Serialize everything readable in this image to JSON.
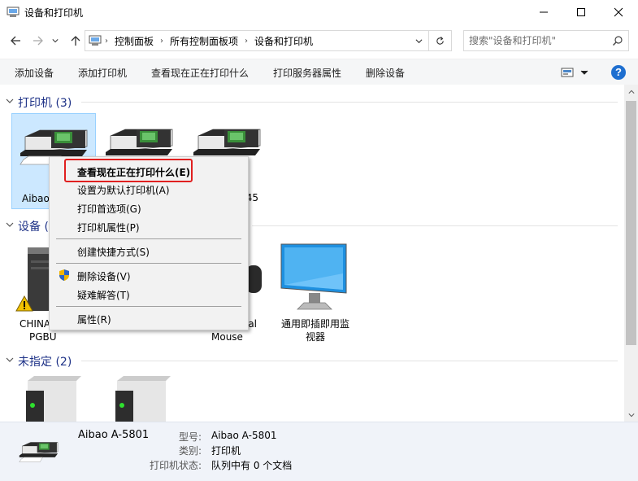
{
  "window": {
    "title": "设备和打印机"
  },
  "address": {
    "crumbs": [
      "控制面板",
      "所有控制面板项",
      "设备和打印机"
    ],
    "search_placeholder": "搜索\"设备和打印机\""
  },
  "toolbar": {
    "add_device": "添加设备",
    "add_printer": "添加打印机",
    "see_printing": "查看现在正在打印什么",
    "print_server": "打印服务器属性",
    "remove_device": "删除设备",
    "help": "?"
  },
  "groups": {
    "printers": {
      "title": "打印机 (3)"
    },
    "devices": {
      "title": "设备 ("
    },
    "unspecified": {
      "title": "未指定 (2)"
    }
  },
  "printers": [
    {
      "label": "Aibao"
    },
    {
      "label": ""
    },
    {
      "label": "45"
    }
  ],
  "devices": [
    {
      "label_line1": "CHINA",
      "label_line2": "PGBU"
    },
    {
      "label_line1": "al",
      "label_line2": "Mouse"
    },
    {
      "label_line1": "通用即插即用监",
      "label_line2": "视器"
    }
  ],
  "context_menu": {
    "items": [
      "查看现在正在打印什么(E)",
      "设置为默认打印机(A)",
      "打印首选项(G)",
      "打印机属性(P)",
      "创建快捷方式(S)",
      "删除设备(V)",
      "疑难解答(T)",
      "属性(R)"
    ]
  },
  "details": {
    "name": "Aibao A-5801",
    "model_label": "型号:",
    "model_value": "Aibao A-5801",
    "category_label": "类别:",
    "category_value": "打印机",
    "status_label": "打印机状态:",
    "status_value": "队列中有 0 个文档"
  },
  "colors": {
    "group_title": "#1e3287",
    "highlight_box": "#e02020",
    "selection": "#cce8ff",
    "help": "#1e6fd0"
  }
}
